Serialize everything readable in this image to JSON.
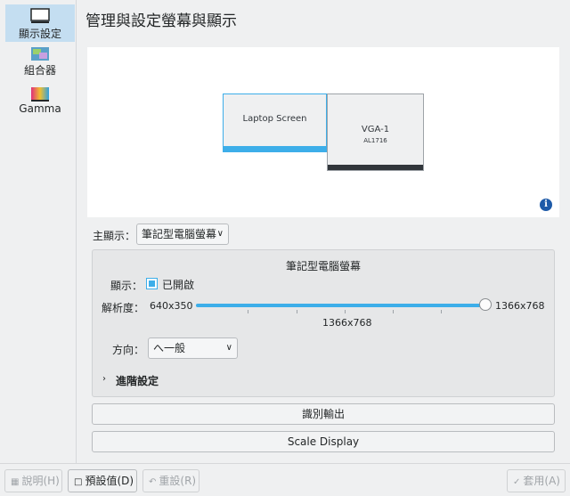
{
  "sidebar": {
    "items": [
      {
        "label": "顯示設定",
        "icon": "monitor-icon",
        "active": true
      },
      {
        "label": "組合器",
        "icon": "compositor-icon",
        "active": false
      },
      {
        "label": "Gamma",
        "icon": "gamma-icon",
        "active": false
      }
    ]
  },
  "header": {
    "title": "管理與設定螢幕與顯示"
  },
  "layout": {
    "screens": [
      {
        "name": "Laptop Screen",
        "sub": ""
      },
      {
        "name": "VGA-1",
        "sub": "AL1716"
      }
    ],
    "info_icon": "i"
  },
  "primary": {
    "label": "主顯示：",
    "value": "筆記型電腦螢幕"
  },
  "output": {
    "title": "筆記型電腦螢幕",
    "show_label": "顯示：",
    "enabled_label": "已開啟",
    "enabled": true,
    "resolution_label": "解析度：",
    "resolution_min": "640x350",
    "resolution_max": "1366x768",
    "resolution_current": "1366x768",
    "resolution_fraction": 1.0,
    "orientation_label": "方向：",
    "orientation_value": "へ一般",
    "advanced_label": "進階設定"
  },
  "actions": {
    "identify": "識別輸出",
    "scale": "Scale Display"
  },
  "footer": {
    "help": "說明(H)",
    "defaults": "預設值(D)",
    "reset": "重設(R)",
    "apply": "套用(A)"
  },
  "colors": {
    "accent": "#3daee9",
    "selected_bg": "#c4def1",
    "info": "#1d5aa8"
  }
}
